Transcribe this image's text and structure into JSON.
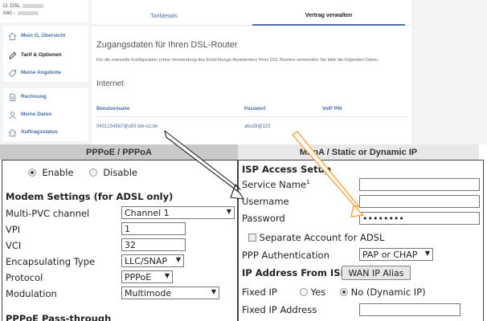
{
  "portal": {
    "account": {
      "line1_prefix": "O, DSL",
      "line2_prefix": "040 -"
    },
    "nav": [
      {
        "label": "Mein O, Übersicht",
        "icon": "home-icon",
        "active": false
      },
      {
        "label": "Tarif & Optionen",
        "icon": "pencil-icon",
        "active": true
      },
      {
        "label": "Meine Angebote",
        "icon": "tag-icon",
        "active": false
      },
      {
        "label": "Rechnung",
        "icon": "document-icon",
        "active": false
      },
      {
        "label": "Meine Daten",
        "icon": "person-icon",
        "active": false
      },
      {
        "label": "Auftragsstatus",
        "icon": "home-icon",
        "active": false
      }
    ],
    "tabs": [
      {
        "label": "Tarifdetails"
      },
      {
        "label": "Vertrag verwalten"
      }
    ],
    "heading": "Zugangsdaten für Ihren DSL-Router",
    "description": "Für die manuelle Konfiguration (ohne Verwendung des Einrichtungs-Assistenten) Ihres DSL Routers verwenden Sie bitte die folgenden Daten.",
    "section": "Internet",
    "columns": {
      "username": "Benutzername",
      "password": "Passwort",
      "voip": "VoIP PIN"
    },
    "row": {
      "username_suffix": "0431234567@o93 bbi-o2.de",
      "password_suffix": "abcd3@123"
    }
  },
  "router": {
    "tabs": {
      "left": "PPPoE / PPPoA",
      "right": "MPoA / Static or Dynamic IP"
    },
    "left": {
      "enable": "Enable",
      "disable": "Disable",
      "modem_heading": "Modem Settings (for ADSL only)",
      "multi_pvc_label": "Multi-PVC channel",
      "multi_pvc_value": "Channel 1",
      "vpi_label": "VPI",
      "vpi_value": "1",
      "vci_label": "VCI",
      "vci_value": "32",
      "encap_label": "Encapsulating Type",
      "encap_value": "LLC/SNAP",
      "protocol_label": "Protocol",
      "protocol_value": "PPPoE",
      "modulation_label": "Modulation",
      "modulation_value": "Multimode",
      "passthrough_heading": "PPPoE Pass-through"
    },
    "right": {
      "isp_heading": "ISP Access Setup",
      "service_label": "Service Name",
      "service_sup": "1",
      "username_label": "Username",
      "password_label": "Password",
      "password_value": "••••••••",
      "separate_label": "Separate Account for ADSL",
      "auth_label": "PPP Authentication",
      "auth_value": "PAP or CHAP",
      "ip_heading": "IP Address From ISP",
      "wan_alias_button": "WAN IP Alias",
      "fixed_ip_label": "Fixed IP",
      "yes_label": "Yes",
      "no_label": "No (Dynamic IP)",
      "fixed_ip_address_label": "Fixed IP Address"
    }
  },
  "colors": {
    "portal_link": "#4a6fa5",
    "username_arrow": "#222222",
    "password_arrow": "#f5a442"
  }
}
